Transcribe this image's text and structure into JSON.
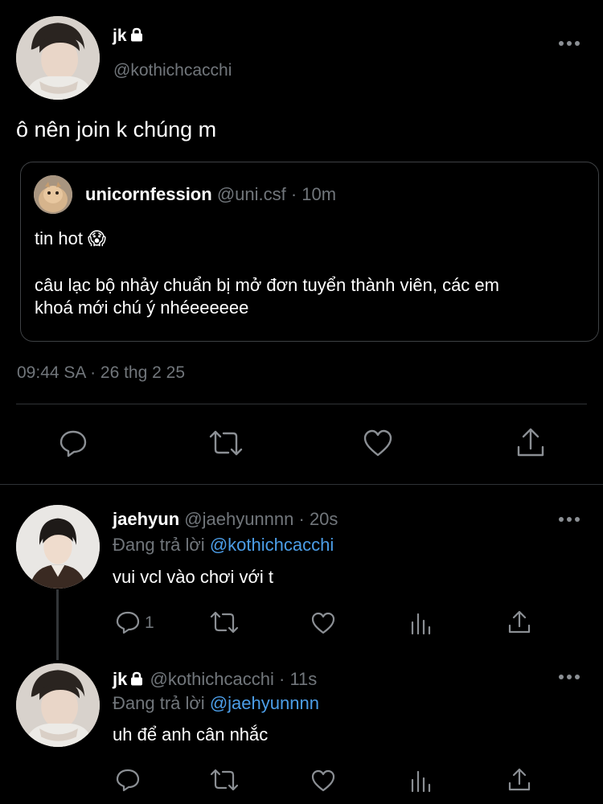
{
  "main_tweet": {
    "display_name": "jk",
    "handle": "@kothichcacchi",
    "text": "ô nên join k chúng m",
    "timestamp": "09:44 SA · 26 thg 2 25",
    "more_icon": "more-horizontal-icon",
    "lock_icon": "lock-icon"
  },
  "quoted_tweet": {
    "display_name": "unicornfession",
    "handle": "@uni.csf",
    "time": "· 10m",
    "line1": "tin hot 😱",
    "line2": "câu lạc bộ nhảy chuẩn bị mở đơn tuyển thành viên, các em",
    "line3": "khoá mới chú ý nhéeeeeee"
  },
  "main_actions": [
    "reply-icon",
    "retweet-icon",
    "like-icon",
    "share-icon"
  ],
  "replies": [
    {
      "display_name": "jaehyun",
      "handle": "@jaehyunnnn",
      "time": "· 20s",
      "replying_prefix": "Đang trả lời",
      "replying_to": "@kothichcacchi",
      "text": "vui vcl vào chơi với t",
      "reply_count": "1"
    },
    {
      "display_name": "jk",
      "handle": "@kothichcacchi",
      "time": "· 11s",
      "replying_prefix": "Đang trả lời",
      "replying_to": "@jaehyunnnn",
      "text": "uh để anh cân nhắc",
      "reply_count": ""
    }
  ],
  "colors": {
    "background": "#000000",
    "link": "#4c9ee8",
    "muted": "#71767b",
    "icon": "#8b8f94"
  }
}
